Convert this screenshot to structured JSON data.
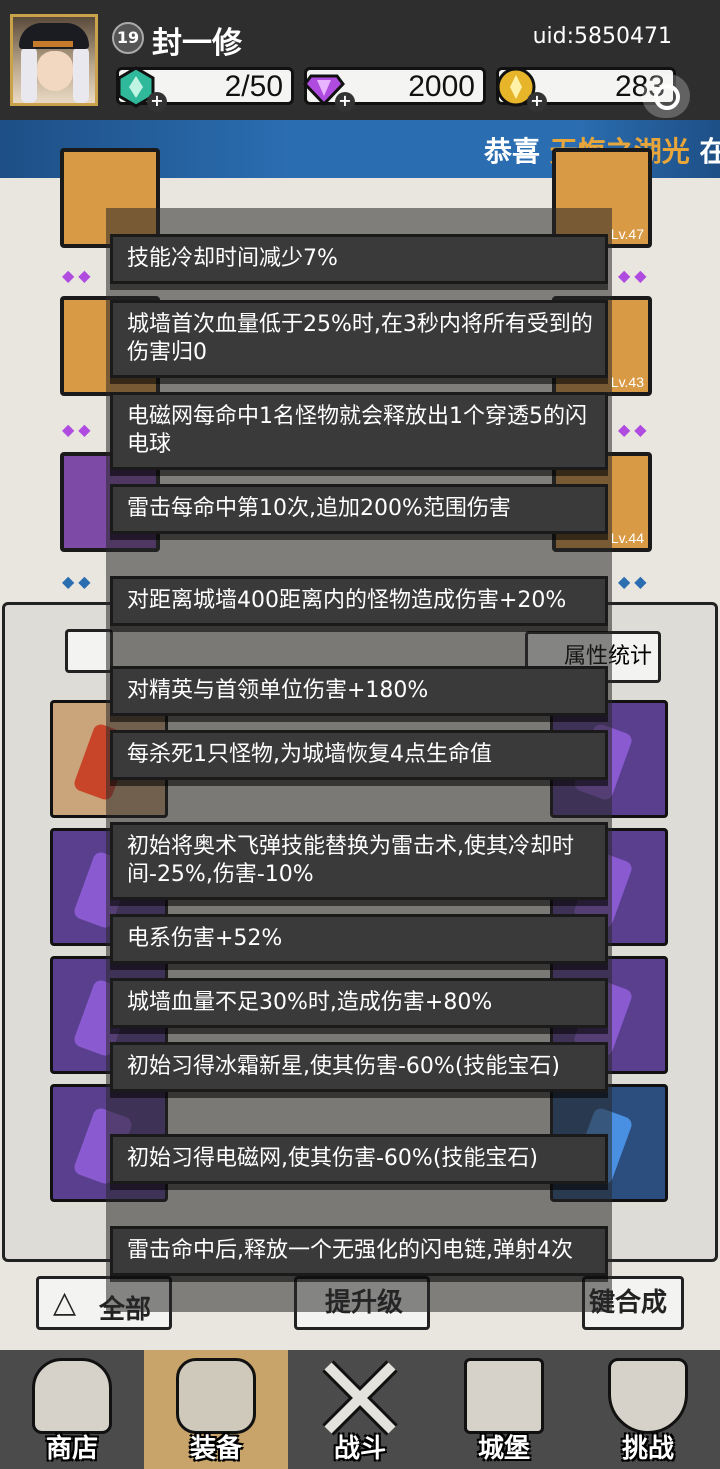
{
  "player": {
    "level": "19",
    "name": "封一修",
    "uid": "uid:5850471"
  },
  "resources": {
    "energy": "2/50",
    "gems": "2000",
    "gold": "283"
  },
  "banner": {
    "prefix": "恭喜",
    "highlight": "无悔之湖光",
    "suffix": "在"
  },
  "equipment_levels": [
    "Lv.47",
    "Lv.43",
    "Lv.44"
  ],
  "tooltip": {
    "lines": [
      "技能冷却时间减少7%",
      "城墙首次血量低于25%时,在3秒内将所有受到的伤害归0",
      "电磁网每命中1名怪物就会释放出1个穿透5的闪电球",
      "雷击每命中第10次,追加200%范围伤害",
      "对距离城墙400距离内的怪物造成伤害+20%",
      "对精英与首领单位伤害+180%",
      "每杀死1只怪物,为城墙恢复4点生命值",
      "初始将奥术飞弹技能替换为雷击术,使其冷却时间-25%,伤害-10%",
      "电系伤害+52%",
      "城墙血量不足30%时,造成伤害+80%",
      "初始习得冰霜新星,使其伤害-60%(技能宝石)",
      "初始习得电磁网,使其伤害-60%(技能宝石)",
      "雷击命中后,释放一个无强化的闪电链,弹射4次"
    ]
  },
  "panel": {
    "stats_tab": "属性统计",
    "filter_all": "全部",
    "upgrade_label": "提升级",
    "merge_label": "键合成"
  },
  "nav": {
    "items": [
      "商店",
      "装备",
      "战斗",
      "城堡",
      "挑战"
    ],
    "active": "装备"
  },
  "colors": {
    "banner": "#2a6db0",
    "banner_highlight": "#e8a53a",
    "tooltip_bg": "#3a3a3a",
    "nav_active": "#c8a46a"
  },
  "icons": {
    "energy": "green-crystal-icon",
    "gems": "purple-diamond-icon",
    "gold": "gold-coin-icon"
  }
}
